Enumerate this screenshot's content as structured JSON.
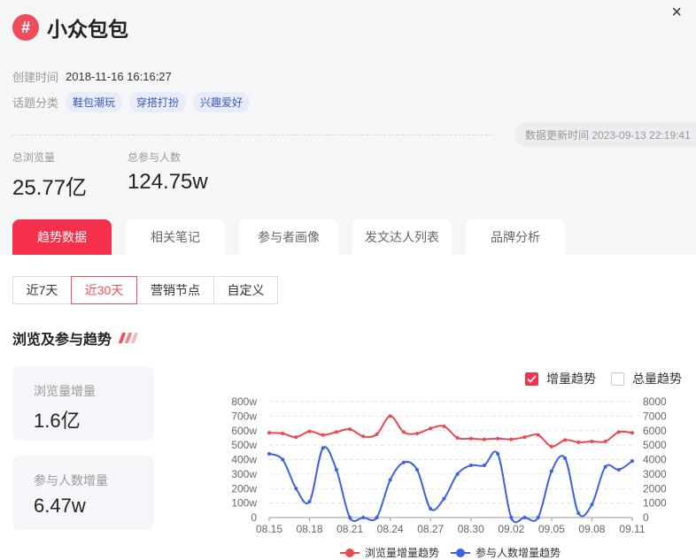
{
  "topic": {
    "title": "小众包包",
    "close_icon": "×"
  },
  "meta": {
    "created_label": "创建时间",
    "created_value": "2018-11-16 16:16:27",
    "category_label": "话题分类",
    "tags": [
      "鞋包潮玩",
      "穿搭打扮",
      "兴趣爱好"
    ]
  },
  "update_time": "数据更新时间 2023-09-13 22:19:41",
  "stats": {
    "views_label": "总浏览量",
    "views_value": "25.77亿",
    "participants_label": "总参与人数",
    "participants_value": "124.75w"
  },
  "tabs": [
    "趋势数据",
    "相关笔记",
    "参与者画像",
    "发文达人列表",
    "品牌分析"
  ],
  "range_buttons": [
    "近7天",
    "近30天",
    "营销节点",
    "自定义"
  ],
  "section_title": "浏览及参与趋势",
  "cards": {
    "views_inc_label": "浏览量增量",
    "views_inc_value": "1.6亿",
    "part_inc_label": "参与人数增量",
    "part_inc_value": "6.47w"
  },
  "toggles": {
    "increment": "增量趋势",
    "total": "总量趋势",
    "increment_checked": true
  },
  "colors": {
    "accent": "#f5304a",
    "views_series": "#e84a4f",
    "participants_series": "#3b62e0"
  },
  "chart_data": {
    "type": "line",
    "x_ticks": [
      "08.15",
      "08.18",
      "08.21",
      "08.24",
      "08.27",
      "08.30",
      "09.02",
      "09.05",
      "09.08",
      "09.11"
    ],
    "x": [
      "08.15",
      "08.16",
      "08.17",
      "08.18",
      "08.19",
      "08.20",
      "08.21",
      "08.22",
      "08.23",
      "08.24",
      "08.25",
      "08.26",
      "08.27",
      "08.28",
      "08.29",
      "08.30",
      "08.31",
      "09.01",
      "09.02",
      "09.03",
      "09.04",
      "09.05",
      "09.06",
      "09.07",
      "09.08",
      "09.09",
      "09.10",
      "09.11"
    ],
    "y_left_ticks": [
      "0",
      "100w",
      "200w",
      "300w",
      "400w",
      "500w",
      "600w",
      "700w",
      "800w"
    ],
    "y_right_ticks": [
      "0",
      "1000",
      "2000",
      "3000",
      "4000",
      "5000",
      "6000",
      "7000",
      "8000"
    ],
    "ylim_left": [
      0,
      800
    ],
    "ylim_right": [
      0,
      8000
    ],
    "grid": true,
    "legend_position": "bottom",
    "series": [
      {
        "name": "浏览量增量趋势",
        "axis": "left",
        "values": [
          585,
          580,
          555,
          595,
          570,
          590,
          610,
          560,
          575,
          700,
          590,
          580,
          615,
          630,
          550,
          545,
          540,
          545,
          540,
          555,
          570,
          490,
          535,
          520,
          525,
          525,
          590,
          585
        ]
      },
      {
        "name": "参与人数增量趋势",
        "axis": "right",
        "values": [
          4400,
          4000,
          2000,
          1100,
          4800,
          3300,
          0,
          0,
          0,
          2600,
          3800,
          3300,
          600,
          1300,
          3000,
          3600,
          3600,
          4400,
          0,
          0,
          0,
          3200,
          4100,
          300,
          900,
          3500,
          3300,
          3900
        ]
      }
    ]
  }
}
